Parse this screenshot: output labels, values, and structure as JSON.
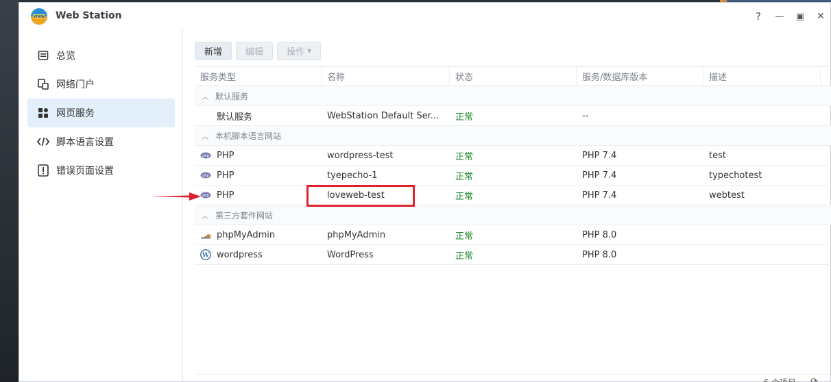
{
  "window": {
    "title": "Web Station"
  },
  "window_controls": {
    "help": "?",
    "minimize": "—",
    "maximize": "▣",
    "close": "✕"
  },
  "sidebar": {
    "items": [
      {
        "label": "总览",
        "icon": "overview-icon"
      },
      {
        "label": "网络门户",
        "icon": "portal-icon"
      },
      {
        "label": "网页服务",
        "icon": "web-service-icon",
        "active": true
      },
      {
        "label": "脚本语言设置",
        "icon": "code-icon"
      },
      {
        "label": "错误页面设置",
        "icon": "error-page-icon"
      }
    ]
  },
  "toolbar": {
    "create": "新增",
    "edit": "编辑",
    "action": "操作"
  },
  "grid": {
    "columns": [
      "服务类型",
      "名称",
      "状态",
      "服务/数据库版本",
      "描述"
    ],
    "groups": [
      {
        "title": "默认服务",
        "rows": [
          {
            "type": "默认服务",
            "icon": "none",
            "name": "WebStation Default Ser...",
            "status": "正常",
            "version": "--",
            "desc": ""
          }
        ]
      },
      {
        "title": "本机脚本语言网站",
        "rows": [
          {
            "type": "PHP",
            "icon": "php-icon",
            "name": "wordpress-test",
            "status": "正常",
            "version": "PHP 7.4",
            "desc": "test"
          },
          {
            "type": "PHP",
            "icon": "php-icon",
            "name": "tyepecho-1",
            "status": "正常",
            "version": "PHP 7.4",
            "desc": "typechotest"
          },
          {
            "type": "PHP",
            "icon": "php-icon",
            "name": "loveweb-test",
            "status": "正常",
            "version": "PHP 7.4",
            "desc": "webtest"
          }
        ]
      },
      {
        "title": "第三方套件网站",
        "rows": [
          {
            "type": "phpMyAdmin",
            "icon": "phpmyadmin-icon",
            "name": "phpMyAdmin",
            "status": "正常",
            "version": "PHP 8.0",
            "desc": ""
          },
          {
            "type": "wordpress",
            "icon": "wordpress-icon",
            "name": "WordPress",
            "status": "正常",
            "version": "PHP 8.0",
            "desc": ""
          }
        ]
      }
    ]
  },
  "footer": {
    "count": "6 个项目"
  },
  "colors": {
    "accent": "#e3effb",
    "status_ok": "#1a8a2a",
    "annotation": "#e0202a"
  }
}
